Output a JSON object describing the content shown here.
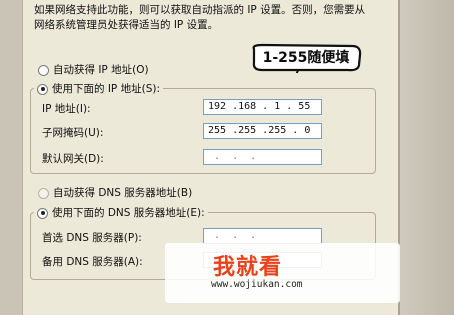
{
  "description": "如果网络支持此功能，则可以获取自动指派的 IP 设置。否则，您需要从网络系统管理员处获得适当的 IP 设置。",
  "ip": {
    "auto_label": "自动获得 IP 地址(O)",
    "manual_label": "使用下面的 IP 地址(S):",
    "address_label": "IP 地址(I):",
    "address_value": "192 .168 . 1 . 55",
    "mask_label": "子网掩码(U):",
    "mask_value": "255 .255 .255 . 0",
    "gateway_label": "默认网关(D):",
    "gateway_value": " .  .  ."
  },
  "dns": {
    "auto_label": "自动获得 DNS 服务器地址(B)",
    "manual_label": "使用下面的 DNS 服务器地址(E):",
    "preferred_label": "首选 DNS 服务器(P):",
    "preferred_value": " .  .  .",
    "alternate_label": "备用 DNS 服务器(A):",
    "alternate_value": " .  .  ."
  },
  "annotation": "1-255随便填",
  "watermark": {
    "logo": "我就看",
    "url": "www.wojiukan.com"
  },
  "colors": {
    "window_bg": "#ece9d8",
    "field_border": "#7f9db9",
    "watermark_accent": "#e8421a"
  }
}
